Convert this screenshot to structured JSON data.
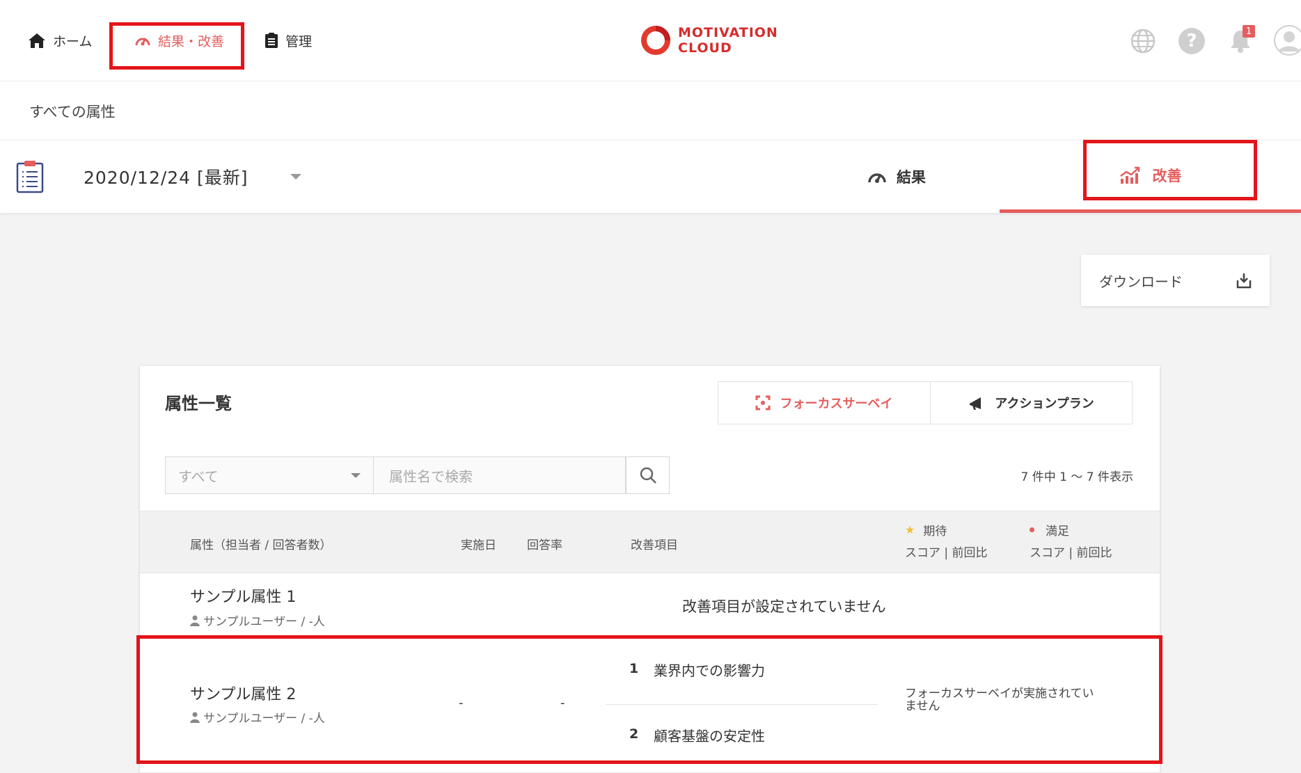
{
  "nav": {
    "home_label": "ホーム",
    "results_label": "結果・改善",
    "manage_label": "管理",
    "logo_line1": "MOTIVATION",
    "logo_line2": "CLOUD",
    "notification_count": "1"
  },
  "breadcrumb": "すべての属性",
  "survey": {
    "date_label": "2020/12/24 [最新]",
    "tab_results": "結果",
    "tab_improve": "改善"
  },
  "download_label": "ダウンロード",
  "panel": {
    "title": "属性一覧",
    "focus_survey_label": "フォーカスサーベイ",
    "action_plan_label": "アクションプラン",
    "filter_select_value": "すべて",
    "search_placeholder": "属性名で検索",
    "count_text": "7 件中 1 ～ 7 件表示",
    "columns": {
      "attribute": "属性（担当者 / 回答者数）",
      "date": "実施日",
      "rate": "回答率",
      "items": "改善項目",
      "expect": "期待",
      "expect_sub": "スコア | 前回比",
      "satisfy": "満足",
      "satisfy_sub": "スコア | 前回比"
    },
    "rows": [
      {
        "name": "サンプル属性 1",
        "owner": "サンプルユーザー / -人",
        "empty_message": "改善項目が設定されていません"
      },
      {
        "name": "サンプル属性 2",
        "owner": "サンプルユーザー / -人",
        "date": "-",
        "rate": "-",
        "item1_no": "1",
        "item1": "業界内での影響力",
        "item2_no": "2",
        "item2": "顧客基盤の安定性",
        "status_line1": "フォーカスサーベイが実施されてい",
        "status_line2": "ません"
      }
    ]
  },
  "colors": {
    "accent": "#e55d5d",
    "highlight_box": "#e3151a",
    "star": "#f2c12e"
  }
}
